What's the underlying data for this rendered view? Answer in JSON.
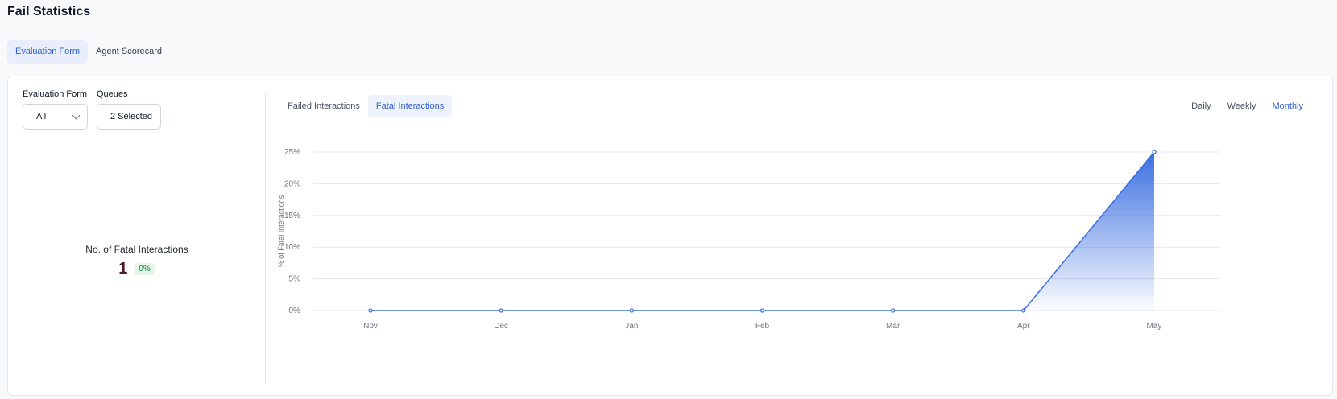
{
  "page": {
    "title": "Fail Statistics"
  },
  "top_tabs": [
    {
      "label": "Evaluation Form",
      "active": true
    },
    {
      "label": "Agent Scorecard",
      "active": false
    }
  ],
  "filters": {
    "evaluation_form": {
      "label": "Evaluation Form",
      "value": "All"
    },
    "queues": {
      "label": "Queues",
      "value": "2 Selected"
    }
  },
  "kpi": {
    "title": "No. of Fatal Interactions",
    "value": "1",
    "change": "0%"
  },
  "chart_tabs": [
    {
      "label": "Failed Interactions",
      "active": false
    },
    {
      "label": "Fatal Interactions",
      "active": true
    }
  ],
  "period_tabs": [
    {
      "label": "Daily",
      "active": false
    },
    {
      "label": "Weekly",
      "active": false
    },
    {
      "label": "Monthly",
      "active": true
    }
  ],
  "colors": {
    "accent": "#2f5fcf",
    "line": "#3b6fe0",
    "grid": "#e5e7eb"
  },
  "chart_data": {
    "type": "area",
    "categories": [
      "Nov",
      "Dec",
      "Jan",
      "Feb",
      "Mar",
      "Apr",
      "May"
    ],
    "series": [
      {
        "values": [
          0,
          0,
          0,
          0,
          0,
          0,
          25
        ]
      }
    ],
    "ylabel": "% of Fatal Interactions",
    "xlabel": "",
    "ylim": [
      0,
      25
    ],
    "yticks": [
      0,
      5,
      10,
      15,
      20,
      25
    ],
    "ytick_labels": [
      "0%",
      "5%",
      "10%",
      "15%",
      "20%",
      "25%"
    ],
    "grid": true
  }
}
